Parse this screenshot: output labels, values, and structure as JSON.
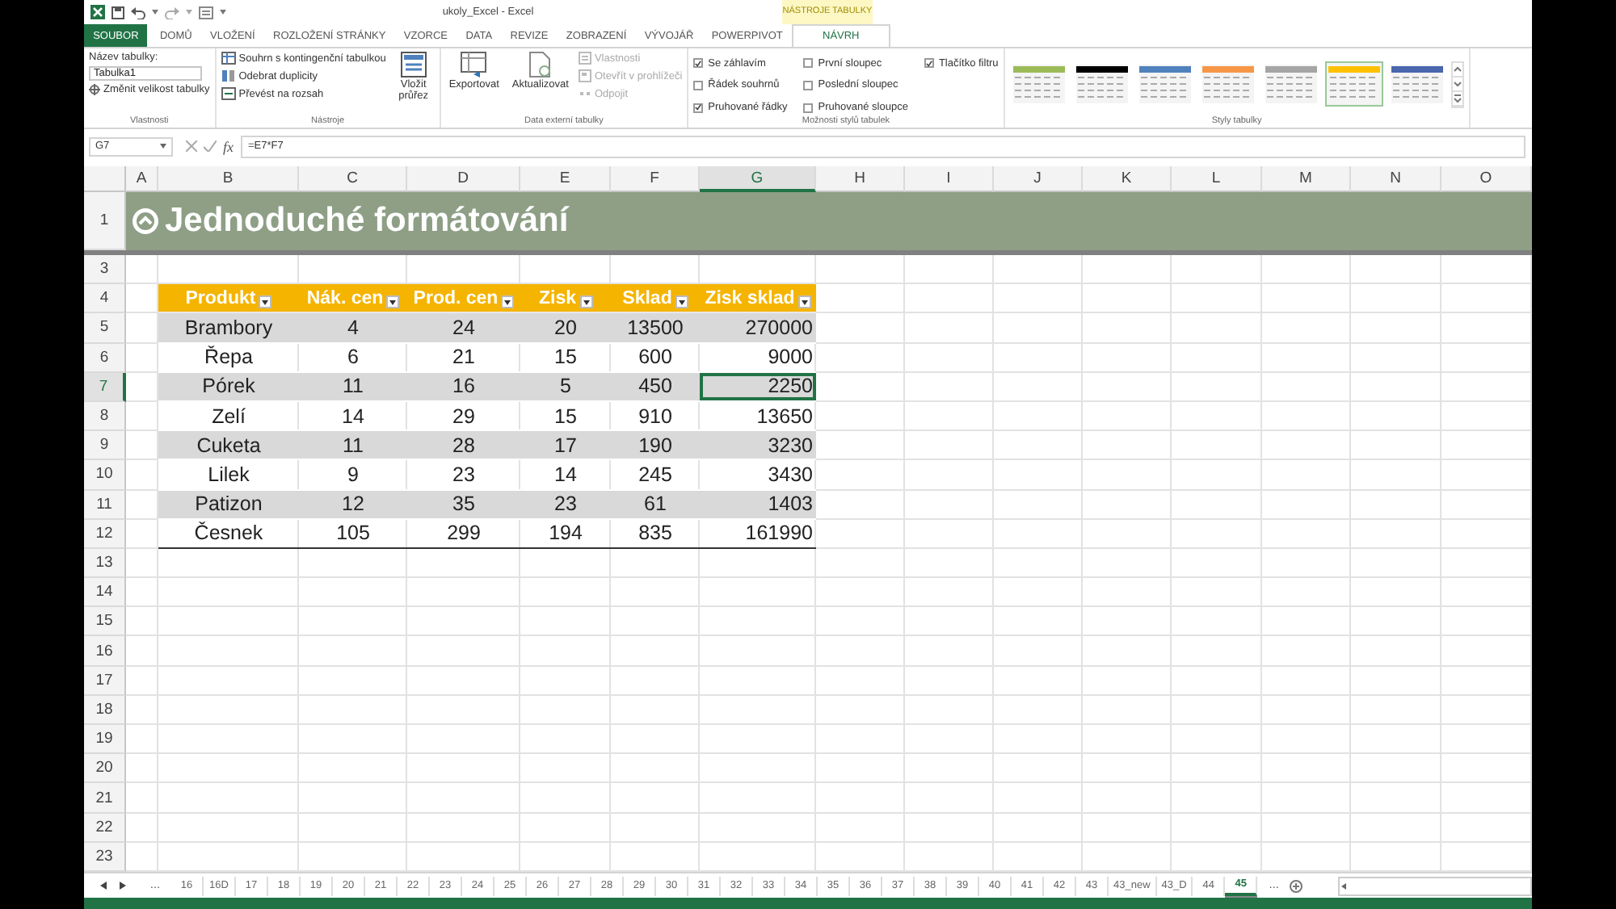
{
  "title_bar": {
    "title": "ukoly_Excel - Excel",
    "context_label": "NÁSTROJE TABULKY"
  },
  "ribbon": {
    "tabs": [
      {
        "label": "SOUBOR",
        "kind": "file",
        "selected": false
      },
      {
        "label": "DOMŮ",
        "kind": "standard",
        "selected": false
      },
      {
        "label": "VLOŽENÍ",
        "kind": "standard",
        "selected": false
      },
      {
        "label": "ROZLOŽENÍ STRÁNKY",
        "kind": "standard",
        "selected": false
      },
      {
        "label": "VZORCE",
        "kind": "standard",
        "selected": false
      },
      {
        "label": "DATA",
        "kind": "standard",
        "selected": false
      },
      {
        "label": "REVIZE",
        "kind": "standard",
        "selected": false
      },
      {
        "label": "ZOBRAZENÍ",
        "kind": "standard",
        "selected": false
      },
      {
        "label": "VÝVOJÁŘ",
        "kind": "standard",
        "selected": false
      },
      {
        "label": "POWERPIVOT",
        "kind": "standard",
        "selected": false
      },
      {
        "label": "NÁVRH",
        "kind": "contextual",
        "selected": true
      }
    ],
    "groups": [
      {
        "kind": "properties",
        "label": "Vlastnosti",
        "name_label": "Název tabulky:",
        "name_value": "Tabulka1",
        "button": "Změnit velikost tabulky"
      },
      {
        "kind": "tools",
        "label": "Nástroje",
        "buttons": [
          {
            "label": "Souhrn s kontingenční tabulkou"
          },
          {
            "label": "Odebrat duplicity"
          },
          {
            "label": "Převést na rozsah"
          }
        ],
        "big_button": "Vložit průřez"
      },
      {
        "kind": "external",
        "label": "Data externí tabulky",
        "big_buttons": [
          {
            "label": "Exportovat"
          },
          {
            "label": "Aktualizovat"
          }
        ],
        "buttons": [
          {
            "label": "Vlastnosti",
            "disabled": true
          },
          {
            "label": "Otevřít v prohlížeči",
            "disabled": true
          },
          {
            "label": "Odpojit",
            "disabled": true
          }
        ]
      },
      {
        "kind": "style_options",
        "label": "Možnosti stylů tabulek",
        "options": [
          {
            "label": "Se záhlavím",
            "checked": true
          },
          {
            "label": "Řádek souhrnů",
            "checked": false
          },
          {
            "label": "Pruhované řádky",
            "checked": true
          },
          {
            "label": "První sloupec",
            "checked": false
          },
          {
            "label": "Poslední sloupec",
            "checked": false
          },
          {
            "label": "Pruhované sloupce",
            "checked": false
          },
          {
            "label": "Tlačítko filtru",
            "checked": true
          }
        ]
      },
      {
        "kind": "styles",
        "label": "Styly tabulky",
        "swatches": [
          {
            "color": "#9bbb59",
            "selected": false
          },
          {
            "color": "#000000",
            "selected": false
          },
          {
            "color": "#4f81bd",
            "selected": false
          },
          {
            "color": "#f79646",
            "selected": false
          },
          {
            "color": "#a5a5a5",
            "selected": false
          },
          {
            "color": "#ffc000",
            "selected": true
          },
          {
            "color": "#4a66ac",
            "selected": false
          }
        ]
      }
    ]
  },
  "formula_bar": {
    "name_box": "G7",
    "function_label": "fx",
    "formula": "=E7*F7"
  },
  "sheet": {
    "columns": [
      {
        "label": "A",
        "selected": false
      },
      {
        "label": "B",
        "selected": false
      },
      {
        "label": "C",
        "selected": false
      },
      {
        "label": "D",
        "selected": false
      },
      {
        "label": "E",
        "selected": false
      },
      {
        "label": "F",
        "selected": false
      },
      {
        "label": "G",
        "selected": true
      },
      {
        "label": "H",
        "selected": false
      },
      {
        "label": "I",
        "selected": false
      },
      {
        "label": "J",
        "selected": false
      },
      {
        "label": "K",
        "selected": false
      },
      {
        "label": "L",
        "selected": false
      },
      {
        "label": "M",
        "selected": false
      },
      {
        "label": "N",
        "selected": false
      },
      {
        "label": "O",
        "selected": false
      }
    ],
    "rows": [
      {
        "label": "1",
        "selected": false
      },
      {
        "label": "3",
        "selected": false
      },
      {
        "label": "4",
        "selected": false
      },
      {
        "label": "5",
        "selected": false
      },
      {
        "label": "6",
        "selected": false
      },
      {
        "label": "7",
        "selected": true
      },
      {
        "label": "8",
        "selected": false
      },
      {
        "label": "9",
        "selected": false
      },
      {
        "label": "10",
        "selected": false
      },
      {
        "label": "11",
        "selected": false
      },
      {
        "label": "12",
        "selected": false
      },
      {
        "label": "13",
        "selected": false
      },
      {
        "label": "14",
        "selected": false
      },
      {
        "label": "15",
        "selected": false
      },
      {
        "label": "16",
        "selected": false
      },
      {
        "label": "17",
        "selected": false
      },
      {
        "label": "18",
        "selected": false
      },
      {
        "label": "19",
        "selected": false
      },
      {
        "label": "20",
        "selected": false
      },
      {
        "label": "21",
        "selected": false
      },
      {
        "label": "22",
        "selected": false
      },
      {
        "label": "23",
        "selected": false
      }
    ],
    "title": "Jednoduché formátování",
    "table": {
      "headers": [
        "Produkt",
        "Nák. cen",
        "Prod. cen",
        "Zisk",
        "Sklad",
        "Zisk sklad"
      ],
      "rows": [
        {
          "shaded": true,
          "cells": [
            {
              "text": "Brambory",
              "selected": false
            },
            {
              "text": "4",
              "selected": false
            },
            {
              "text": "24",
              "selected": false
            },
            {
              "text": "20",
              "selected": false
            },
            {
              "text": "13500",
              "selected": false
            },
            {
              "text": "270000",
              "selected": false
            }
          ]
        },
        {
          "shaded": false,
          "cells": [
            {
              "text": "Řepa",
              "selected": false
            },
            {
              "text": "6",
              "selected": false
            },
            {
              "text": "21",
              "selected": false
            },
            {
              "text": "15",
              "selected": false
            },
            {
              "text": "600",
              "selected": false
            },
            {
              "text": "9000",
              "selected": false
            }
          ]
        },
        {
          "shaded": true,
          "cells": [
            {
              "text": "Pórek",
              "selected": false
            },
            {
              "text": "11",
              "selected": false
            },
            {
              "text": "16",
              "selected": false
            },
            {
              "text": "5",
              "selected": false
            },
            {
              "text": "450",
              "selected": false
            },
            {
              "text": "2250",
              "selected": true
            }
          ]
        },
        {
          "shaded": false,
          "cells": [
            {
              "text": "Zelí",
              "selected": false
            },
            {
              "text": "14",
              "selected": false
            },
            {
              "text": "29",
              "selected": false
            },
            {
              "text": "15",
              "selected": false
            },
            {
              "text": "910",
              "selected": false
            },
            {
              "text": "13650",
              "selected": false
            }
          ]
        },
        {
          "shaded": true,
          "cells": [
            {
              "text": "Cuketa",
              "selected": false
            },
            {
              "text": "11",
              "selected": false
            },
            {
              "text": "28",
              "selected": false
            },
            {
              "text": "17",
              "selected": false
            },
            {
              "text": "190",
              "selected": false
            },
            {
              "text": "3230",
              "selected": false
            }
          ]
        },
        {
          "shaded": false,
          "cells": [
            {
              "text": "Lilek",
              "selected": false
            },
            {
              "text": "9",
              "selected": false
            },
            {
              "text": "23",
              "selected": false
            },
            {
              "text": "14",
              "selected": false
            },
            {
              "text": "245",
              "selected": false
            },
            {
              "text": "3430",
              "selected": false
            }
          ]
        },
        {
          "shaded": true,
          "cells": [
            {
              "text": "Patizon",
              "selected": false
            },
            {
              "text": "12",
              "selected": false
            },
            {
              "text": "35",
              "selected": false
            },
            {
              "text": "23",
              "selected": false
            },
            {
              "text": "61",
              "selected": false
            },
            {
              "text": "1403",
              "selected": false
            }
          ]
        },
        {
          "shaded": false,
          "cells": [
            {
              "text": "Česnek",
              "selected": false
            },
            {
              "text": "105",
              "selected": false
            },
            {
              "text": "299",
              "selected": false
            },
            {
              "text": "194",
              "selected": false
            },
            {
              "text": "835",
              "selected": false
            },
            {
              "text": "161990",
              "selected": false
            }
          ]
        }
      ]
    }
  },
  "sheet_tabs": [
    {
      "label": "…",
      "kind": "more",
      "selected": false
    },
    {
      "label": "16",
      "kind": "sheet",
      "selected": false
    },
    {
      "label": "16D",
      "kind": "sheet",
      "selected": false
    },
    {
      "label": "17",
      "kind": "sheet",
      "selected": false
    },
    {
      "label": "18",
      "kind": "sheet",
      "selected": false
    },
    {
      "label": "19",
      "kind": "sheet",
      "selected": false
    },
    {
      "label": "20",
      "kind": "sheet",
      "selected": false
    },
    {
      "label": "21",
      "kind": "sheet",
      "selected": false
    },
    {
      "label": "22",
      "kind": "sheet",
      "selected": false
    },
    {
      "label": "23",
      "kind": "sheet",
      "selected": false
    },
    {
      "label": "24",
      "kind": "sheet",
      "selected": false
    },
    {
      "label": "25",
      "kind": "sheet",
      "selected": false
    },
    {
      "label": "26",
      "kind": "sheet",
      "selected": false
    },
    {
      "label": "27",
      "kind": "sheet",
      "selected": false
    },
    {
      "label": "28",
      "kind": "sheet",
      "selected": false
    },
    {
      "label": "29",
      "kind": "sheet",
      "selected": false
    },
    {
      "label": "30",
      "kind": "sheet",
      "selected": false
    },
    {
      "label": "31",
      "kind": "sheet",
      "selected": false
    },
    {
      "label": "32",
      "kind": "sheet",
      "selected": false
    },
    {
      "label": "33",
      "kind": "sheet",
      "selected": false
    },
    {
      "label": "34",
      "kind": "sheet",
      "selected": false
    },
    {
      "label": "35",
      "kind": "sheet",
      "selected": false
    },
    {
      "label": "36",
      "kind": "sheet",
      "selected": false
    },
    {
      "label": "37",
      "kind": "sheet",
      "selected": false
    },
    {
      "label": "38",
      "kind": "sheet",
      "selected": false
    },
    {
      "label": "39",
      "kind": "sheet",
      "selected": false
    },
    {
      "label": "40",
      "kind": "sheet",
      "selected": false
    },
    {
      "label": "41",
      "kind": "sheet",
      "selected": false
    },
    {
      "label": "42",
      "kind": "sheet",
      "selected": false
    },
    {
      "label": "43",
      "kind": "sheet",
      "selected": false
    },
    {
      "label": "43_new",
      "kind": "sheet",
      "selected": false
    },
    {
      "label": "43_D",
      "kind": "sheet",
      "selected": false
    },
    {
      "label": "44",
      "kind": "sheet",
      "selected": false
    },
    {
      "label": "45",
      "kind": "sheet",
      "selected": true
    },
    {
      "label": "…",
      "kind": "more",
      "selected": false
    }
  ]
}
